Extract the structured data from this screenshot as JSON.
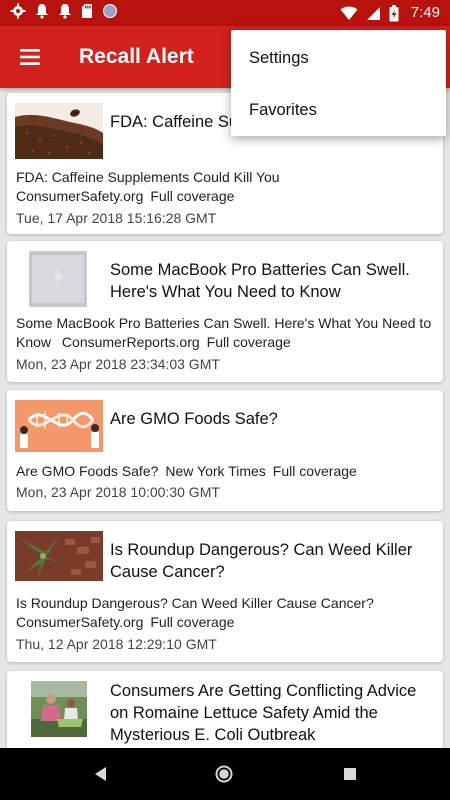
{
  "status_bar": {
    "time": "7:49",
    "left_icons": [
      "gear-icon",
      "notification-icon",
      "notification-icon",
      "sd-card-icon",
      "circle-icon"
    ],
    "right_icons": [
      "wifi-icon",
      "signal-icon",
      "battery-charging-icon"
    ]
  },
  "app_bar": {
    "title": "Recall Alert",
    "menu_icon": "hamburger-menu-icon"
  },
  "overflow_menu": {
    "items": [
      {
        "label": "Settings"
      },
      {
        "label": "Favorites"
      }
    ]
  },
  "feed": {
    "cards": [
      {
        "title": "FDA: Caffeine Su",
        "meta_text": "FDA: Caffeine Supplements Could Kill You",
        "source": "ConsumerSafety.org",
        "coverage": "Full coverage",
        "date": "Tue, 17 Apr 2018 15:16:28 GMT",
        "thumb": "coffee-powder-image"
      },
      {
        "title": "Some MacBook Pro Batteries Can Swell. Here's What You Need to Know",
        "meta_text": "Some MacBook Pro Batteries Can Swell. Here's What You Need to Know",
        "source": "ConsumerReports.org",
        "coverage": "Full coverage",
        "date": "Mon, 23 Apr 2018 23:34:03 GMT",
        "thumb": "laptop-image"
      },
      {
        "title": "Are GMO Foods Safe?",
        "meta_text": "Are GMO Foods Safe?",
        "source": "New York Times",
        "coverage": "Full coverage",
        "date": "Mon, 23 Apr 2018 10:00:30 GMT",
        "thumb": "dna-illustration-image"
      },
      {
        "title": "Is Roundup Dangerous? Can Weed Killer Cause Cancer?",
        "meta_text": "Is Roundup Dangerous? Can Weed Killer Cause Cancer?",
        "source": "ConsumerSafety.org",
        "coverage": "Full coverage",
        "date": "Thu, 12 Apr 2018 12:29:10 GMT",
        "thumb": "weed-plant-image"
      },
      {
        "title": "Consumers Are Getting Conflicting Advice on Romaine Lettuce Safety Amid the Mysterious E. Coli Outbreak",
        "thumb": "farm-workers-image"
      }
    ]
  },
  "nav_bar": {
    "buttons": [
      "back-icon",
      "home-icon",
      "recents-icon"
    ]
  }
}
